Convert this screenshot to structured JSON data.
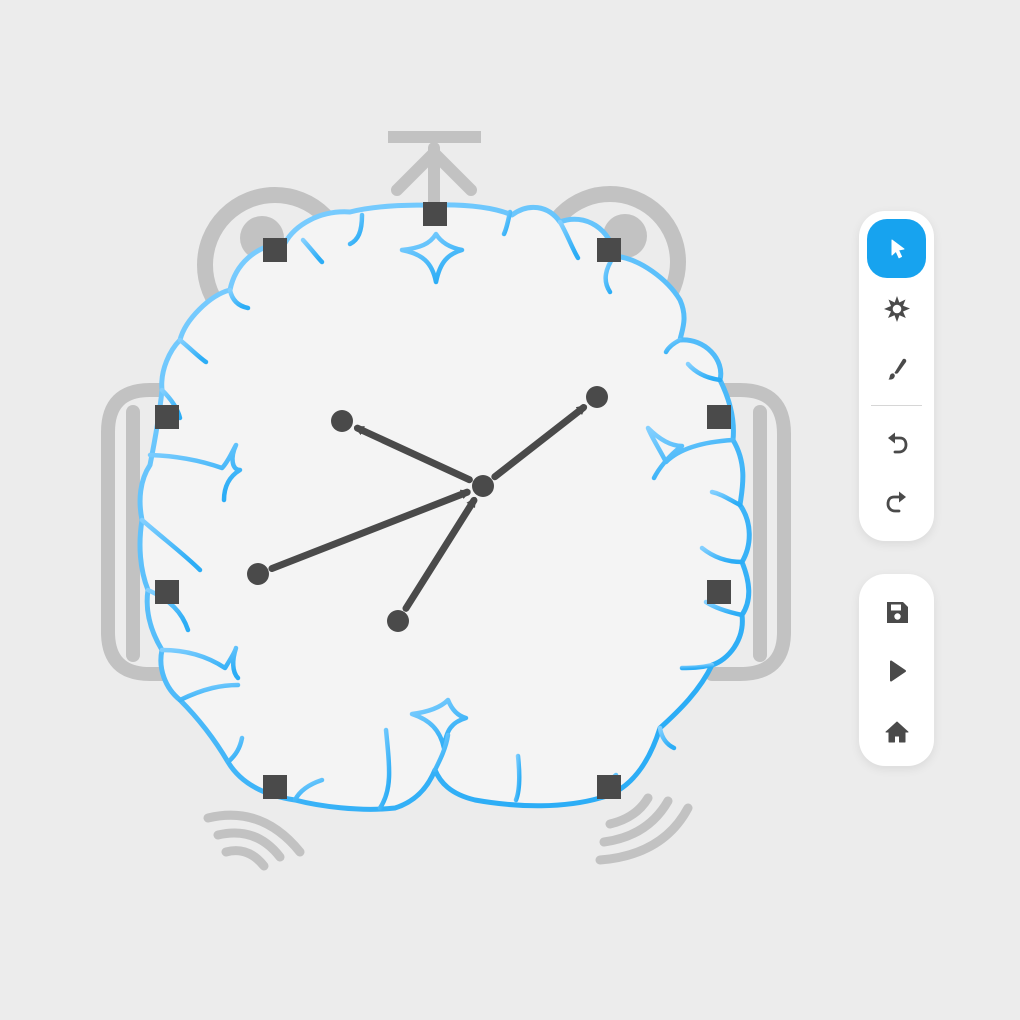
{
  "colors": {
    "background": "#ececec",
    "canvas_fill": "#f4f4f4",
    "outline_light": "#84d0ff",
    "outline_dark": "#2cadf6",
    "accent": "#17a3ef",
    "handle": "#4a4a4a",
    "ghost": "#c2c2c2"
  },
  "canvas": {
    "shape": "brain-outline",
    "node_count": 5,
    "edge_count": 4,
    "selection_handles": 8
  },
  "toolbar": {
    "tools": [
      {
        "name": "select",
        "icon": "cursor-arrow-icon",
        "active": true
      },
      {
        "name": "gear",
        "icon": "spiky-gear-icon",
        "active": false
      },
      {
        "name": "brush",
        "icon": "brush-icon",
        "active": false
      },
      {
        "name": "undo",
        "icon": "undo-icon",
        "active": false
      },
      {
        "name": "redo",
        "icon": "redo-icon",
        "active": false
      }
    ],
    "actions": [
      {
        "name": "save",
        "icon": "floppy-disk-icon"
      },
      {
        "name": "play",
        "icon": "play-icon"
      },
      {
        "name": "home",
        "icon": "home-icon"
      }
    ]
  }
}
